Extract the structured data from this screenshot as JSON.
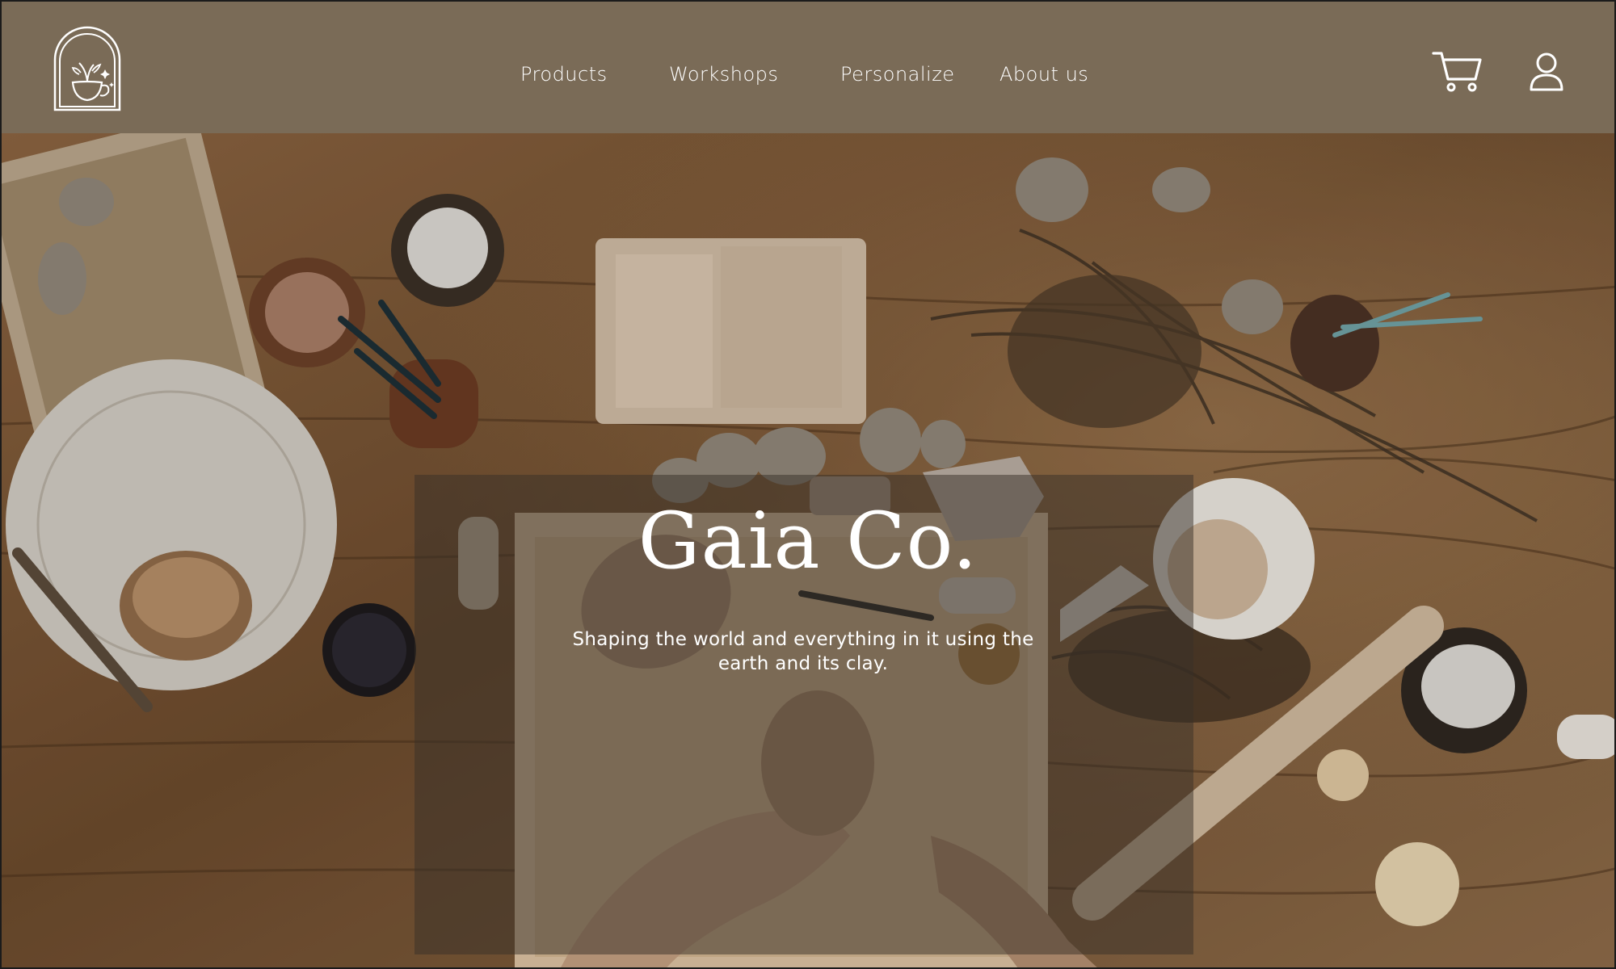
{
  "header": {
    "logo_icon": "teapot-arch-logo-icon",
    "nav": [
      {
        "label": "Products"
      },
      {
        "label": "Workshops"
      },
      {
        "label": "Personalize"
      },
      {
        "label": "About us"
      }
    ],
    "cart_icon": "cart-icon",
    "account_icon": "user-icon"
  },
  "hero": {
    "title": "Gaia Co.",
    "subtitle": "Shaping the world and everything in it using the earth and its clay.",
    "background": "pottery-workbench-photo"
  },
  "colors": {
    "header_bg": "#7a6b57",
    "text": "#ffffff",
    "overlay": "#373028"
  }
}
